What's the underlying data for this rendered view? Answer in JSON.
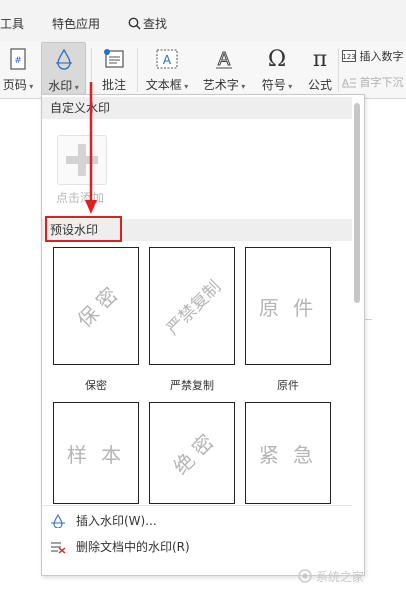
{
  "tabs": {
    "tools": "工具",
    "special": "特色应用",
    "search": "查找"
  },
  "ribbon": {
    "page_number": "页码",
    "watermark": "水印",
    "comment": "批注",
    "textbox": "文本框",
    "wordart": "艺术字",
    "symbol": "符号",
    "formula": "公式",
    "insert_number": "插入数字",
    "drop_cap": "首字下沉"
  },
  "dropdown": {
    "custom_header": "自定义水印",
    "add_label": "点击添加",
    "preset_header": "预设水印",
    "presets": [
      {
        "watermark": "保 密",
        "label": "保密"
      },
      {
        "watermark": "严禁复制",
        "label": "严禁复制"
      },
      {
        "watermark": "原 件",
        "label": "原件"
      },
      {
        "watermark": "样 本",
        "label": ""
      },
      {
        "watermark": "绝 密",
        "label": ""
      },
      {
        "watermark": "紧 急",
        "label": ""
      }
    ],
    "insert_item": "插入水印(W)...",
    "delete_item": "删除文档中的水印(R)"
  },
  "site_watermark": "系统之家",
  "colors": {
    "annotation_red": "#e02020",
    "watermark_gray": "#b5b5b5",
    "icon_blue": "#2b6cc4"
  }
}
